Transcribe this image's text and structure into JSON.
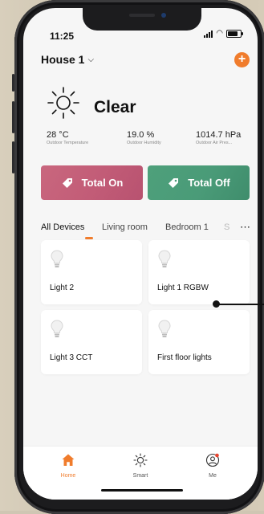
{
  "status_bar": {
    "time": "11:25",
    "battery_level": 0.8
  },
  "header": {
    "home_name": "House 1",
    "add_icon": "plus-icon"
  },
  "weather": {
    "condition": "Clear",
    "icon": "sun-icon",
    "stats": [
      {
        "value": "28 °C",
        "label": "Outdoor Temperature"
      },
      {
        "value": "19.0 %",
        "label": "Outdoor Humidity"
      },
      {
        "value": "1014.7 hPa",
        "label": "Outdoor Air Pres..."
      }
    ]
  },
  "actions": {
    "total_on": "Total On",
    "total_off": "Total Off",
    "on_color": "#c25c77",
    "off_color": "#4a9b78"
  },
  "tabs": [
    {
      "label": "All Devices",
      "active": true
    },
    {
      "label": "Living room",
      "active": false
    },
    {
      "label": "Bedroom 1",
      "active": false
    },
    {
      "label": "S",
      "active": false
    }
  ],
  "devices": [
    {
      "name": "Light 2",
      "icon": "light-bulb-icon"
    },
    {
      "name": "Light 1 RGBW",
      "icon": "light-bulb-icon"
    },
    {
      "name": "Light 3 CCT",
      "icon": "light-bulb-icon"
    },
    {
      "name": "First floor lights",
      "icon": "light-bulb-icon"
    }
  ],
  "tab_bar": [
    {
      "label": "Home",
      "icon": "home-icon",
      "active": true
    },
    {
      "label": "Smart",
      "icon": "sun-icon",
      "active": false
    },
    {
      "label": "Me",
      "icon": "profile-icon",
      "active": false
    }
  ],
  "accent_color": "#f07c2c"
}
